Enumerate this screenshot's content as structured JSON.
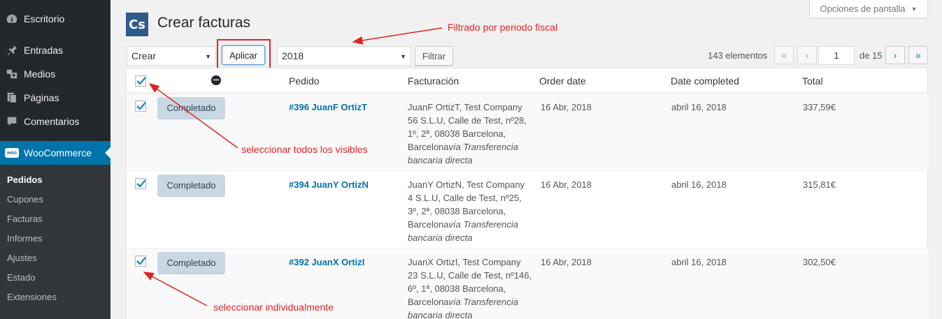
{
  "sidebar": {
    "items": [
      {
        "label": "Escritorio",
        "icon": "dashboard-icon"
      },
      {
        "label": "Entradas",
        "icon": "pin-icon"
      },
      {
        "label": "Medios",
        "icon": "media-icon"
      },
      {
        "label": "Páginas",
        "icon": "pages-icon"
      },
      {
        "label": "Comentarios",
        "icon": "comment-icon"
      },
      {
        "label": "WooCommerce",
        "icon": "woo-icon"
      }
    ],
    "woo_badge": "woo",
    "submenu": [
      "Pedidos",
      "Cupones",
      "Facturas",
      "Informes",
      "Ajustes",
      "Estado",
      "Extensiones"
    ]
  },
  "header": {
    "screen_options": "Opciones de pantalla",
    "logo_text": "Cs",
    "title": "Crear facturas"
  },
  "toolbar": {
    "bulk_action": "Crear",
    "apply_label": "Aplicar",
    "year": "2018",
    "filter_label": "Filtrar",
    "items_count": "143 elementos",
    "first_page": "«",
    "prev_page": "‹",
    "current_page": "1",
    "page_total": "de 15",
    "next_page": "›",
    "last_page": "»"
  },
  "table": {
    "columns": [
      "Pedido",
      "Facturación",
      "Order date",
      "Date completed",
      "Total"
    ],
    "rows": [
      {
        "status": "Completado",
        "order": "#396 JuanF OrtizT",
        "billing_lines": [
          "JuanF OrtizT, Test Company",
          "56 S.L.U, Calle de Test, nº28,",
          "1º, 2ª, 08038 Barcelona,"
        ],
        "billing_last": "Barcelona",
        "billing_via_1": "vía Transferencia",
        "billing_via_2": "bancaria directa",
        "order_date": "16 Abr, 2018",
        "date_completed": "abril 16, 2018",
        "total": "337,59€"
      },
      {
        "status": "Completado",
        "order": "#394 JuanY OrtizN",
        "billing_lines": [
          "JuanY OrtizN, Test Company",
          "4 S.L.U, Calle de Test, nº25,",
          "3º, 2ª, 08038 Barcelona,"
        ],
        "billing_last": "Barcelona",
        "billing_via_1": "vía Transferencia",
        "billing_via_2": "bancaria directa",
        "order_date": "16 Abr, 2018",
        "date_completed": "abril 16, 2018",
        "total": "315,81€"
      },
      {
        "status": "Completado",
        "order": "#392 JuanX OrtizI",
        "billing_lines": [
          "JuanX OrtizI, Test Company",
          "23 S.L.U, Calle de Test, nº146,",
          "6º, 1ª, 08038 Barcelona,"
        ],
        "billing_last": "Barcelona",
        "billing_via_1": "vía Transferencia",
        "billing_via_2": "bancaria directa",
        "order_date": "16 Abr, 2018",
        "date_completed": "abril 16, 2018",
        "total": "302,50€"
      }
    ]
  },
  "annotations": {
    "fiscal_filter": "Filtrado por periodo fiscal",
    "select_all": "seleccionar todos los visibles",
    "select_individual": "seleccionar individualmente",
    "color": "#e02424"
  }
}
